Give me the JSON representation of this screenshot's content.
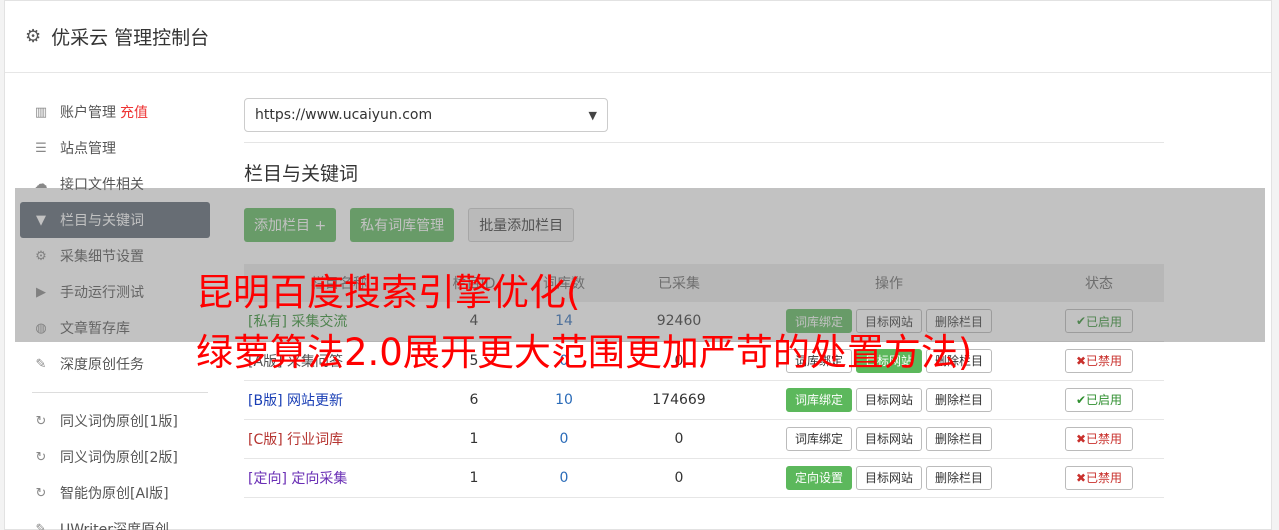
{
  "app": {
    "title": "优采云 管理控制台"
  },
  "sidebar": {
    "items": [
      {
        "label": "账户管理",
        "badge": "充值",
        "icon": "bar-chart-icon"
      },
      {
        "label": "站点管理",
        "icon": "server-icon"
      },
      {
        "label": "接口文件相关",
        "icon": "cloud-upload-icon"
      },
      {
        "label": "栏目与关键词",
        "icon": "filter-icon"
      },
      {
        "label": "采集细节设置",
        "icon": "cogs-icon"
      },
      {
        "label": "手动运行测试",
        "icon": "play-circle-icon"
      },
      {
        "label": "文章暂存库",
        "icon": "database-icon"
      },
      {
        "label": "深度原创任务",
        "icon": "edit-icon"
      }
    ],
    "items2": [
      {
        "label": "同义词伪原创[1版]",
        "icon": "refresh-icon"
      },
      {
        "label": "同义词伪原创[2版]",
        "icon": "refresh-icon"
      },
      {
        "label": "智能伪原创[AI版]",
        "icon": "refresh-icon"
      },
      {
        "label": "UWriter深度原创",
        "icon": "edit-icon"
      }
    ]
  },
  "main": {
    "site_select": "https://www.ucaiyun.com",
    "section_title": "栏目与关键词",
    "buttons": {
      "add": "添加栏目 +",
      "private_lib": "私有词库管理",
      "batch_add": "批量添加栏目"
    },
    "table": {
      "headers": [
        "栏目名称",
        "栏目ID",
        "词库数",
        "已采集",
        "操作",
        "状态"
      ],
      "rows": [
        {
          "tag": "[私有]",
          "name": "采集交流",
          "id": "4",
          "words": "14",
          "collected": "92460",
          "op1": "词库绑定",
          "op2": "目标网站",
          "op3": "删除栏目",
          "status": "已启用"
        },
        {
          "tag": "[A版]",
          "name": "采集问答",
          "id": "5",
          "words": "0",
          "collected": "0",
          "op1": "词库绑定",
          "op2": "目标网站",
          "op3": "删除栏目",
          "status": "已禁用"
        },
        {
          "tag": "[B版]",
          "name": "网站更新",
          "id": "6",
          "words": "10",
          "collected": "174669",
          "op1": "词库绑定",
          "op2": "目标网站",
          "op3": "删除栏目",
          "status": "已启用"
        },
        {
          "tag": "[C版]",
          "name": "行业词库",
          "id": "1",
          "words": "0",
          "collected": "0",
          "op1": "词库绑定",
          "op2": "目标网站",
          "op3": "删除栏目",
          "status": "已禁用"
        },
        {
          "tag": "[定向]",
          "name": "定向采集",
          "id": "1",
          "words": "0",
          "collected": "0",
          "op1": "定向设置",
          "op2": "目标网站",
          "op3": "删除栏目",
          "status": "已禁用"
        }
      ]
    }
  },
  "overlay": {
    "line1": "昆明百度搜索引擎优化(",
    "line2": "绿萝算法2.0展开更大范围更加严苛的处置方法)"
  },
  "colors": {
    "accent_green": "#5cb85c",
    "active_sidebar": "#5a6472",
    "danger": "#c9302c",
    "overlay_text": "#ff0000"
  }
}
